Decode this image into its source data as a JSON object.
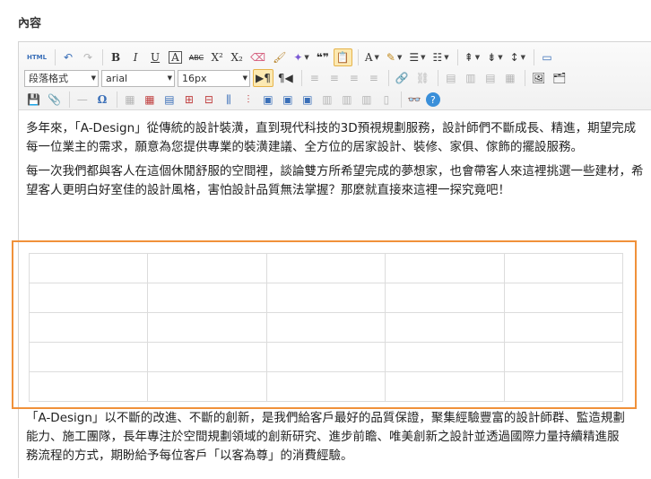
{
  "section": {
    "label": "內容"
  },
  "toolbar": {
    "html_label": "HTML",
    "undo_icon": "undo-icon",
    "redo_icon": "redo-icon",
    "bold": "B",
    "italic": "I",
    "underline": "U",
    "font_border": "A",
    "strike": "ABC",
    "superscript": "X²",
    "subscript": "X₂",
    "quote": "❝❞",
    "font_color": "A",
    "paragraph_format": "段落格式",
    "font_family": "arial",
    "font_size": "16px",
    "omega": "Ω"
  },
  "content": {
    "para1": "多年來，「A-Design」從傳統的設計裝潢，直到現代科技的3D預視規劃服務，設計師們不斷成長、精進，期望完成每一位業主的需求，願意為您提供專業的裝潢建議、全方位的居家設計、裝修、家俱、傢飾的擺設服務。",
    "para2": "每一次我們都與客人在這個休閒舒服的空間裡，談論雙方所希望完成的夢想家，也會帶客人來這裡挑選一些建材，希望客人更明白好室佳的設計風格，害怕設計品質無法掌握？那麼就直接來這裡一探究竟吧！",
    "para3": "「A-Design」以不斷的改進、不斷的創新，是我們給客戶最好的品質保證，聚集經驗豐富的設計師群、監造規劃能力、施工團隊，長年專注於空間規劃領域的創新研究、進步前瞻、唯美創新之設計並透過國際力量持續精進服務流程的方式，期盼給予每位客戶「以客為尊」的消費經驗。"
  },
  "colors": {
    "highlight": "#f0913a",
    "accent": "#3a6fb8"
  }
}
